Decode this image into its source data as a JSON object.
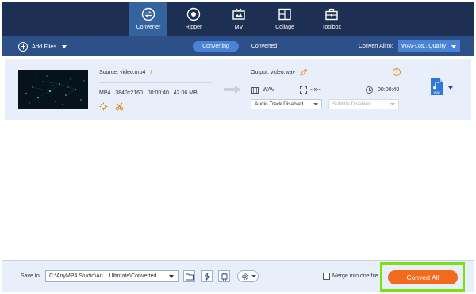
{
  "nav": {
    "tabs": [
      {
        "label": "Converter",
        "icon": "converter-icon",
        "active": true
      },
      {
        "label": "Ripper",
        "icon": "ripper-icon",
        "active": false
      },
      {
        "label": "MV",
        "icon": "mv-icon",
        "active": false
      },
      {
        "label": "Collage",
        "icon": "collage-icon",
        "active": false
      },
      {
        "label": "Toolbox",
        "icon": "toolbox-icon",
        "active": false
      }
    ]
  },
  "toolbar": {
    "add_files_label": "Add Files",
    "segments": [
      "Converting",
      "Converted"
    ],
    "active_segment": "Converting",
    "convert_all_to_label": "Convert All to:",
    "format_value": "WAV-Los...Quality"
  },
  "file": {
    "source_label": "Source: video.mp4",
    "meta": "MP4   3840x2160   00:00:40   42.06 MB",
    "output_label": "Output: video.wav",
    "output_format": "WAV",
    "output_resolution": "--x--",
    "output_duration": "00:00:40",
    "audio_track": "Audio Track Disabled",
    "subtitle": "Subtitle Disabled",
    "format_badge": "WAV"
  },
  "footer": {
    "save_to_label": "Save to:",
    "save_path": "C:\\AnyMP4 Studio\\An... Ultimate\\Converted",
    "merge_label": "Merge into one file",
    "convert_all_label": "Convert All"
  },
  "colors": {
    "nav_bg": "#1d2f52",
    "nav_active": "#34639e",
    "toolbar_bg": "#2e5088",
    "accent_blue": "#4a83d6",
    "row_bg": "#e8eefa",
    "convert_orange": "#f26a1b",
    "highlight_green": "#7de010"
  }
}
